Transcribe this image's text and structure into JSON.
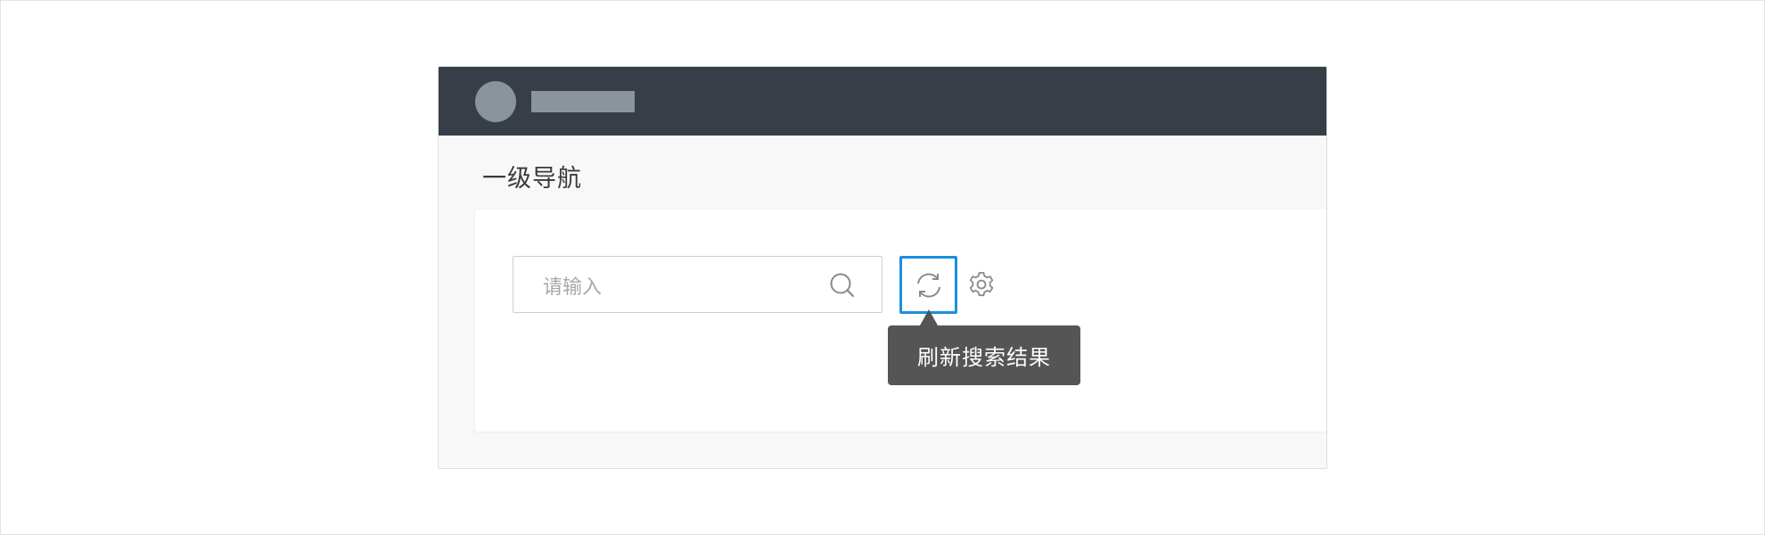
{
  "header": {
    "avatar_icon": "avatar-placeholder",
    "title_placeholder": "title-placeholder"
  },
  "page": {
    "title": "一级导航"
  },
  "toolbar": {
    "search": {
      "value": "",
      "placeholder": "请输入",
      "icon": "search-icon"
    },
    "refresh": {
      "icon": "refresh-icon",
      "tooltip": "刷新搜索结果",
      "state": "focused"
    },
    "settings": {
      "icon": "gear-icon"
    }
  },
  "colors": {
    "header_bg": "#373e48",
    "accent_focus": "#1a8fe0",
    "tooltip_bg": "#555555",
    "placeholder_gray": "#8a949c"
  }
}
